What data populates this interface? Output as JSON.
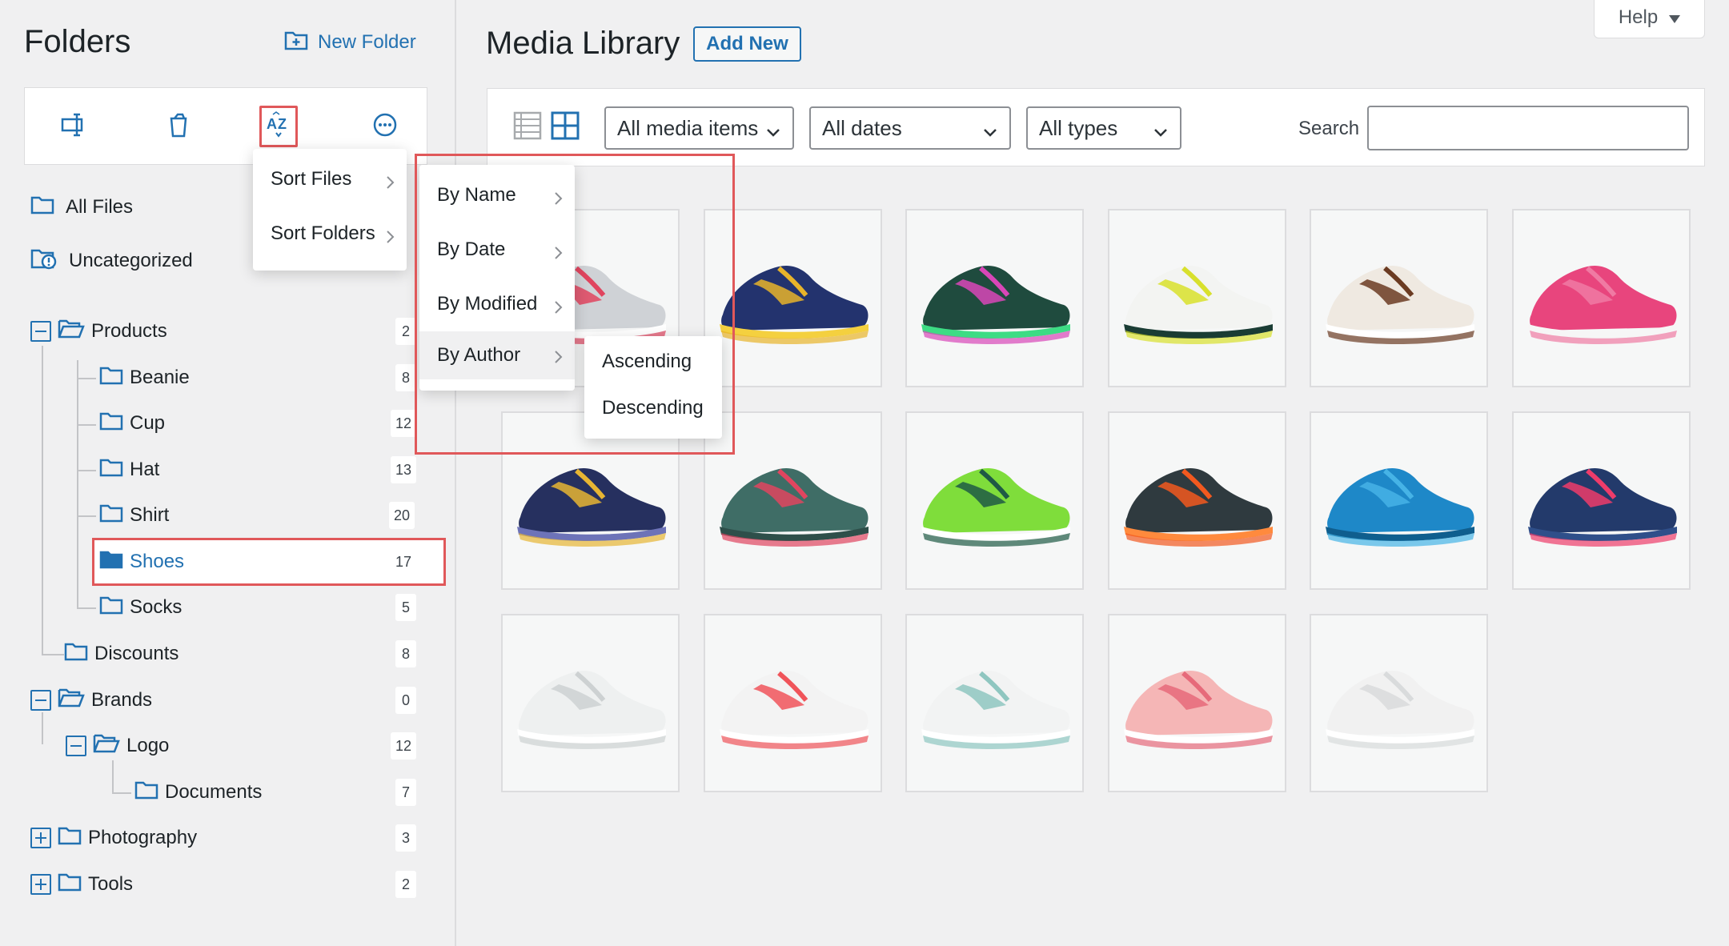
{
  "sidebar": {
    "title": "Folders",
    "new_folder_label": "New Folder",
    "all_files_label": "All Files",
    "uncategorized_label": "Uncategorized",
    "folders": [
      {
        "name": "Products",
        "count": "2"
      },
      {
        "name": "Beanie",
        "count": "8"
      },
      {
        "name": "Cup",
        "count": "12"
      },
      {
        "name": "Hat",
        "count": "13"
      },
      {
        "name": "Shirt",
        "count": "20"
      },
      {
        "name": "Shoes",
        "count": "17"
      },
      {
        "name": "Socks",
        "count": "5"
      },
      {
        "name": "Discounts",
        "count": "8"
      },
      {
        "name": "Brands",
        "count": "0"
      },
      {
        "name": "Logo",
        "count": "12"
      },
      {
        "name": "Documents",
        "count": "7"
      },
      {
        "name": "Photography",
        "count": "3"
      },
      {
        "name": "Tools",
        "count": "2"
      }
    ]
  },
  "sort_menu": {
    "items": [
      {
        "label": "Sort Files"
      },
      {
        "label": "Sort Folders"
      }
    ]
  },
  "sort_by_menu": {
    "items": [
      {
        "label": "By Name"
      },
      {
        "label": "By Date"
      },
      {
        "label": "By Modified"
      },
      {
        "label": "By Author"
      }
    ]
  },
  "order_menu": {
    "items": [
      {
        "label": "Ascending"
      },
      {
        "label": "Descending"
      }
    ]
  },
  "main": {
    "title": "Media Library",
    "add_new_label": "Add New",
    "help_label": "Help",
    "filters": {
      "media": "All media items",
      "dates": "All dates",
      "types": "All types",
      "search_label": "Search",
      "search_value": ""
    }
  },
  "media_items": [
    {
      "colors": [
        "#cfd2d6",
        "#e0455f",
        "#ffffff"
      ]
    },
    {
      "colors": [
        "#23336e",
        "#e8b42a",
        "#f4d03f"
      ]
    },
    {
      "colors": [
        "#1f4b3e",
        "#d946b8",
        "#3ddc84"
      ]
    },
    {
      "colors": [
        "#f3f4f2",
        "#d8e02c",
        "#1a3c34"
      ]
    },
    {
      "colors": [
        "#efe9e1",
        "#6b3b22",
        "#ffffff"
      ]
    },
    {
      "colors": [
        "#e8457d",
        "#f07aa3",
        "#f6f6f6"
      ]
    },
    {
      "colors": [
        "#26305f",
        "#e7b533",
        "#6d73b8"
      ]
    },
    {
      "colors": [
        "#3f6d66",
        "#e0455f",
        "#2e4f4a"
      ]
    },
    {
      "colors": [
        "#7fdd3b",
        "#1f5a45",
        "#ffffff"
      ]
    },
    {
      "colors": [
        "#2f3a3f",
        "#f2591f",
        "#ff8a3d"
      ]
    },
    {
      "colors": [
        "#1e88c8",
        "#46b3e6",
        "#0f5e8e"
      ]
    },
    {
      "colors": [
        "#233a6b",
        "#ee3c6a",
        "#2f4f8a"
      ]
    },
    {
      "colors": [
        "#eef0f0",
        "#cdd1d2",
        "#ffffff"
      ]
    },
    {
      "colors": [
        "#f3f3f3",
        "#f0545a",
        "#ffffff"
      ]
    },
    {
      "colors": [
        "#f2f3f3",
        "#8fc6c0",
        "#ffffff"
      ]
    },
    {
      "colors": [
        "#f5b6b6",
        "#e66a7a",
        "#ffffff"
      ]
    },
    {
      "colors": [
        "#f1f1f1",
        "#d9dbdc",
        "#ffffff"
      ]
    }
  ],
  "colors": {
    "accent": "#2271b1",
    "highlight": "#e0585a"
  }
}
